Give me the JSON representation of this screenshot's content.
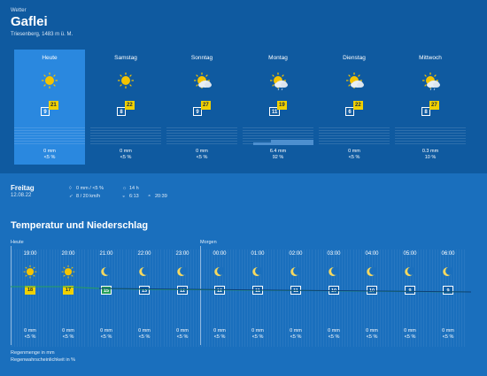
{
  "header": {
    "section_label": "Wetter",
    "city": "Gaflei",
    "region": "Triesenberg, 1483 m ü. M."
  },
  "days": [
    {
      "name": "Heute",
      "icon": "sun-icon",
      "tmin": "9",
      "tmax": "21",
      "rain": "0 mm",
      "prob": "<5 %",
      "rain_level": 0
    },
    {
      "name": "Samstag",
      "icon": "sun-icon",
      "tmin": "8",
      "tmax": "22",
      "rain": "0 mm",
      "prob": "<5 %",
      "rain_level": 0
    },
    {
      "name": "Sonntag",
      "icon": "sun-cloud-icon",
      "tmin": "9",
      "tmax": "27",
      "rain": "0 mm",
      "prob": "<5 %",
      "rain_level": 0
    },
    {
      "name": "Montag",
      "icon": "sun-cloud-rain-icon",
      "tmin": "11",
      "tmax": "19",
      "rain": "6.4 mm",
      "prob": "92 %",
      "rain_level": 0.5
    },
    {
      "name": "Dienstag",
      "icon": "sun-cloud-icon",
      "tmin": "6",
      "tmax": "22",
      "rain": "0 mm",
      "prob": "<5 %",
      "rain_level": 0
    },
    {
      "name": "Mittwoch",
      "icon": "sun-cloud-rain-icon",
      "tmin": "8",
      "tmax": "27",
      "rain": "0.3 mm",
      "prob": "10 %",
      "rain_level": 0
    }
  ],
  "detail": {
    "day": "Freitag",
    "date": "12.08.22",
    "precip": "0 mm / <5 %",
    "wind": "8 / 20 km/h",
    "sunshine": "14 h",
    "sunrise": "6:13",
    "sunset": "20:39"
  },
  "hourly": {
    "title": "Temperatur und Niederschlag",
    "today_label": "Heute",
    "tomorrow_label": "Morgen",
    "hours": [
      {
        "time": "19:00",
        "icon": "sun-icon",
        "temp": "18",
        "rain": "0 mm",
        "prob": "<5 %",
        "style": "warm"
      },
      {
        "time": "20:00",
        "icon": "sun-icon",
        "temp": "17",
        "rain": "0 mm",
        "prob": "<5 %",
        "style": "warm"
      },
      {
        "time": "21:00",
        "icon": "moon-icon",
        "temp": "15",
        "rain": "0 mm",
        "prob": "<5 %",
        "style": "mid"
      },
      {
        "time": "22:00",
        "icon": "moon-icon",
        "temp": "13",
        "rain": "0 mm",
        "prob": "<5 %",
        "style": "cold"
      },
      {
        "time": "23:00",
        "icon": "moon-icon",
        "temp": "12",
        "rain": "0 mm",
        "prob": "<5 %",
        "style": "cold"
      },
      {
        "time": "00:00",
        "icon": "moon-icon",
        "temp": "12",
        "rain": "0 mm",
        "prob": "<5 %",
        "style": "cold"
      },
      {
        "time": "01:00",
        "icon": "moon-icon",
        "temp": "11",
        "rain": "0 mm",
        "prob": "<5 %",
        "style": "cold"
      },
      {
        "time": "02:00",
        "icon": "moon-icon",
        "temp": "11",
        "rain": "0 mm",
        "prob": "<5 %",
        "style": "cold"
      },
      {
        "time": "03:00",
        "icon": "moon-icon",
        "temp": "10",
        "rain": "0 mm",
        "prob": "<5 %",
        "style": "cold"
      },
      {
        "time": "04:00",
        "icon": "moon-icon",
        "temp": "10",
        "rain": "0 mm",
        "prob": "<5 %",
        "style": "cold"
      },
      {
        "time": "05:00",
        "icon": "moon-icon",
        "temp": "9",
        "rain": "0 mm",
        "prob": "<5 %",
        "style": "cold"
      },
      {
        "time": "06:00",
        "icon": "moon-icon",
        "temp": "9",
        "rain": "0 mm",
        "prob": "<5 %",
        "style": "cold"
      }
    ]
  },
  "legend": {
    "line1": "Regenmenge in mm",
    "line2": "Regenwahrscheinlichkeit in %"
  },
  "colors": {
    "header_bg": "#0f5aa0",
    "active_day": "#2a88df",
    "lower_bg": "#1a6fbd",
    "warm_badge": "#f0d000",
    "temp_line": "#27a05a"
  }
}
